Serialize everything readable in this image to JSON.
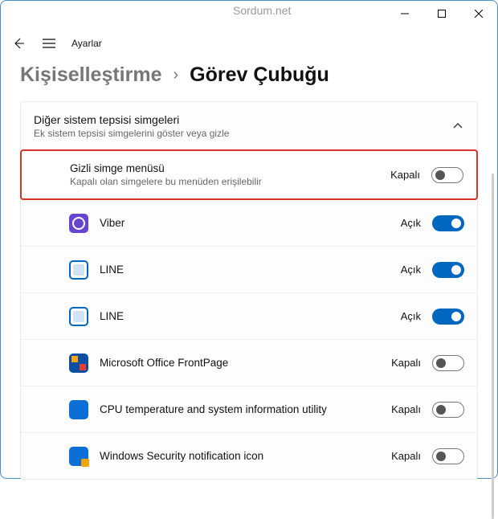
{
  "watermark": "Sordum.net",
  "app_name": "Ayarlar",
  "breadcrumb": {
    "parent": "Kişiselleştirme",
    "sep": "›",
    "current": "Görev Çubuğu"
  },
  "section": {
    "title": "Diğer sistem tepsisi simgeleri",
    "subtitle": "Ek sistem tepsisi simgelerini göster veya gizle"
  },
  "states": {
    "on": "Açık",
    "off": "Kapalı"
  },
  "rows": [
    {
      "title": "Gizli simge menüsü",
      "sub": "Kapalı olan simgelere bu menüden erişilebilir",
      "state": "off",
      "highlight": true,
      "icon": ""
    },
    {
      "title": "Viber",
      "sub": "",
      "state": "on",
      "highlight": false,
      "icon": "icon-viber"
    },
    {
      "title": "LINE",
      "sub": "",
      "state": "on",
      "highlight": false,
      "icon": "icon-line"
    },
    {
      "title": "LINE",
      "sub": "",
      "state": "on",
      "highlight": false,
      "icon": "icon-line"
    },
    {
      "title": "Microsoft Office FrontPage",
      "sub": "",
      "state": "off",
      "highlight": false,
      "icon": "icon-frontpage"
    },
    {
      "title": "CPU temperature and system information utility",
      "sub": "",
      "state": "off",
      "highlight": false,
      "icon": "icon-cpu"
    },
    {
      "title": "Windows Security notification icon",
      "sub": "",
      "state": "off",
      "highlight": false,
      "icon": "icon-sec"
    }
  ]
}
